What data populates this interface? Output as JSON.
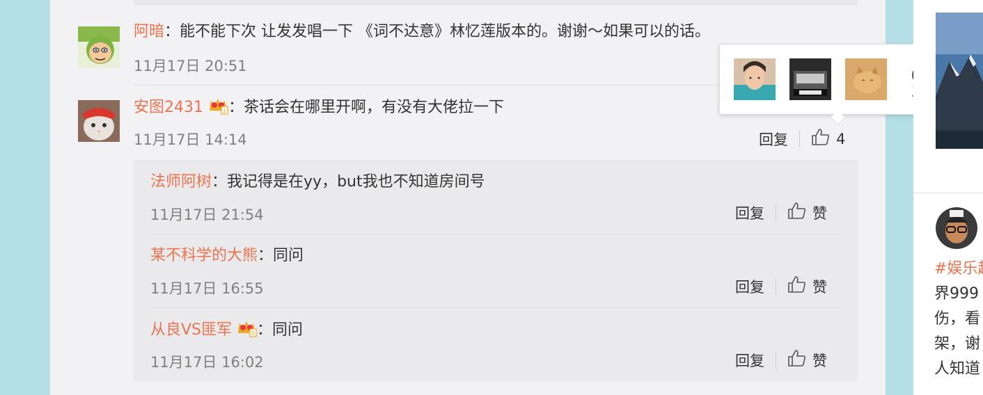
{
  "comments": [
    {
      "name": "阿暗",
      "separator": "：",
      "text": "能不能下次 让发发唱一下 《词不达意》林忆莲版本的。谢谢～如果可以的话。",
      "time": "11月17日 20:51"
    },
    {
      "name": "安图2431",
      "separator": "：",
      "text": "茶话会在哪里开啊，有没有大佬拉一下",
      "time": "11月17日 14:14",
      "reply_label": "回复",
      "like_count": "4"
    }
  ],
  "replies": [
    {
      "name": "法师阿树",
      "separator": "：",
      "text": "我记得是在yy，but我也不知道房间号",
      "time": "11月17日 21:54",
      "reply_label": "回复",
      "like_label": "赞"
    },
    {
      "name": "某不科学的大熊",
      "separator": "：",
      "text": "同问",
      "time": "11月17日 16:55",
      "reply_label": "回复",
      "like_label": "赞"
    },
    {
      "name": "从良VS匪军",
      "separator": "：",
      "text": "同问",
      "time": "11月17日 16:02",
      "reply_label": "回复",
      "like_label": "赞"
    }
  ],
  "sidebar": {
    "hashtag": "#娱乐超",
    "lines": [
      "界999",
      "伤，看",
      "架，谢",
      "人知道"
    ]
  },
  "colors": {
    "accent": "#eb7350",
    "background": "#b5dfe7",
    "panel": "#f2f2f5"
  },
  "icons": [
    "thumbs-up-icon",
    "vip-crown-icon"
  ]
}
